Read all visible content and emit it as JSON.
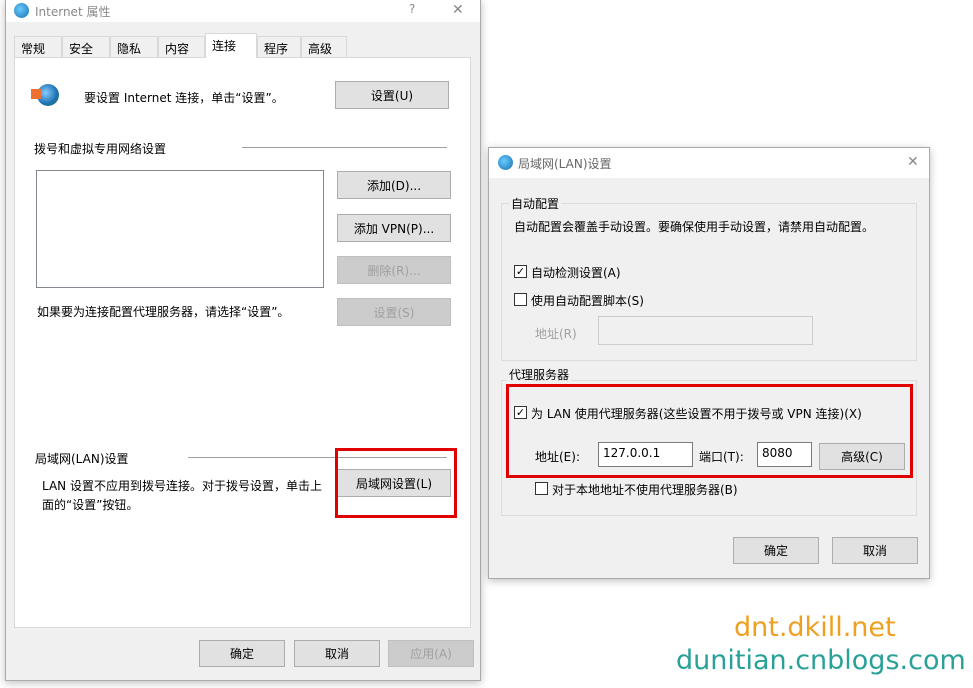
{
  "main": {
    "title": "Internet 属性",
    "help": "?",
    "close": "✕",
    "tabs": [
      "常规",
      "安全",
      "隐私",
      "内容",
      "连接",
      "程序",
      "高级"
    ],
    "setup_text": "要设置 Internet 连接，单击“设置”。",
    "setup_btn": "设置(U)",
    "dialup_header": "拨号和虚拟专用网络设置",
    "add_btn": "添加(D)...",
    "add_vpn_btn": "添加 VPN(P)...",
    "remove_btn": "删除(R)...",
    "settings_btn": "设置(S)",
    "proxy_hint": "如果要为连接配置代理服务器，请选择“设置”。",
    "lan_header": "局域网(LAN)设置",
    "lan_text": "LAN 设置不应用到拨号连接。对于拨号设置，单击上面的“设置”按钮。",
    "lan_btn": "局域网设置(L)",
    "ok": "确定",
    "cancel": "取消",
    "apply": "应用(A)"
  },
  "lan": {
    "title": "局域网(LAN)设置",
    "close": "✕",
    "auto_group": "自动配置",
    "auto_desc": "自动配置会覆盖手动设置。要确保使用手动设置，请禁用自动配置。",
    "auto_detect": "自动检测设置(A)",
    "auto_detect_checked": true,
    "auto_script": "使用自动配置脚本(S)",
    "auto_script_checked": false,
    "addr_label": "地址(R)",
    "addr_value": "",
    "proxy_group": "代理服务器",
    "use_proxy": "为 LAN 使用代理服务器(这些设置不用于拨号或 VPN 连接)(X)",
    "use_proxy_checked": true,
    "proxy_addr_label": "地址(E):",
    "proxy_addr": "127.0.0.1",
    "port_label": "端口(T):",
    "port": "8080",
    "advanced": "高级(C)",
    "bypass_local": "对于本地地址不使用代理服务器(B)",
    "bypass_local_checked": false,
    "ok": "确定",
    "cancel": "取消"
  },
  "watermark": {
    "line1": "dnt.dkill.net",
    "line2": "dunitian.cnblogs.com"
  },
  "colors": {
    "highlight": "#e00000",
    "wm1": "#f0a020",
    "wm2": "#2aa198"
  }
}
